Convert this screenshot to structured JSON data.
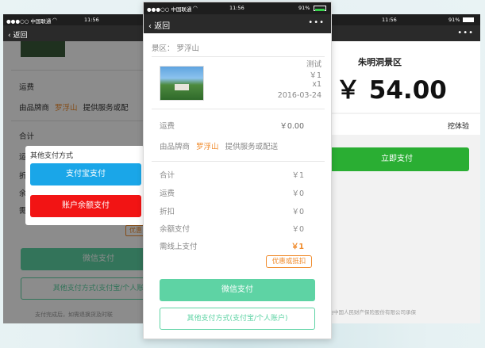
{
  "left": {
    "status": {
      "carrier": "●●●○○ 中国联通",
      "time": "11:56"
    },
    "nav": {
      "back": "返回"
    },
    "freight_label": "运费",
    "merchant": {
      "prefix": "由品牌商",
      "name": "罗浮山",
      "suffix": "提供服务或配"
    },
    "total_label": "合计",
    "side_chars": [
      "运",
      "折",
      "余",
      "需"
    ],
    "dialog": {
      "title": "其他支付方式",
      "alipay": "支付宝支付",
      "balance": "账户余额支付"
    },
    "coupon_partial": "优惠",
    "wechat_btn": "微信支付",
    "other_btn": "其他支付方式(支付宝/个人账",
    "footer": "支付完成后，如需退换货及时联"
  },
  "middle": {
    "status": {
      "carrier": "●●●○○ 中国联通",
      "time": "11:56",
      "battery": "91%"
    },
    "nav": {
      "back": "返回",
      "dots": "•••"
    },
    "scenic": {
      "label": "景区：",
      "name": "罗浮山"
    },
    "product": {
      "name": "测试",
      "price": "￥1",
      "qty": "x1",
      "date": "2016-03-24"
    },
    "freight": {
      "label": "运费",
      "value": "￥0.00"
    },
    "merchant": {
      "prefix": "由品牌商",
      "name": "罗浮山",
      "suffix": "提供服务或配送"
    },
    "summary": [
      {
        "label": "合计",
        "value": "￥1"
      },
      {
        "label": "运费",
        "value": "￥0"
      },
      {
        "label": "折扣",
        "value": "￥0"
      },
      {
        "label": "余额支付",
        "value": "￥0"
      },
      {
        "label": "需线上支付",
        "value": "￥1"
      }
    ],
    "coupon": "优惠或抵扣",
    "wechat_btn": "微信支付",
    "other_btn": "其他支付方式(支付宝/个人账户)"
  },
  "right": {
    "status": {
      "time": "11:56",
      "battery": "91%"
    },
    "nav": {
      "dots": "•••"
    },
    "merchant": "朱明洞景区",
    "amount": "￥ 54.00",
    "tag": "挖体验",
    "pay_btn": "立即支付",
    "footer": "全由中国人民财产保险股份有限公司承保"
  },
  "colors": {
    "accent_orange": "#f08c2e",
    "wechat_green": "#5ed3a4",
    "pay_green": "#2aae33",
    "alipay_blue": "#1aa6e8",
    "balance_red": "#f21414",
    "dark_bar": "#1e1e1e"
  }
}
